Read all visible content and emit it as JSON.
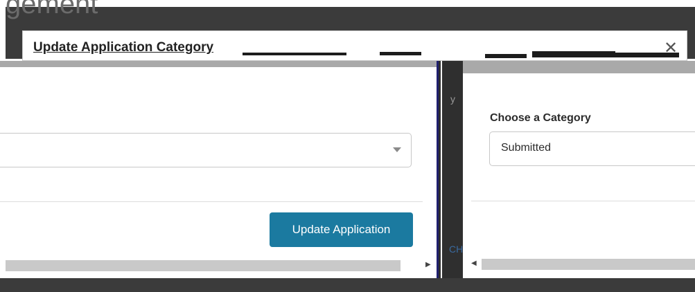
{
  "background": {
    "heading_fragment": "gement"
  },
  "modal": {
    "title": "Update Application Category",
    "close_glyph": "✕"
  },
  "left_panel": {
    "select_value": "",
    "update_button_label": "Update Application"
  },
  "middle": {
    "text_y": "y",
    "text_ch": "CH"
  },
  "right_panel": {
    "label": "Choose a Category",
    "select_value": "Submitted"
  },
  "colors": {
    "primary_button": "#1b7aa0",
    "overlay": "#3b3b3b"
  }
}
